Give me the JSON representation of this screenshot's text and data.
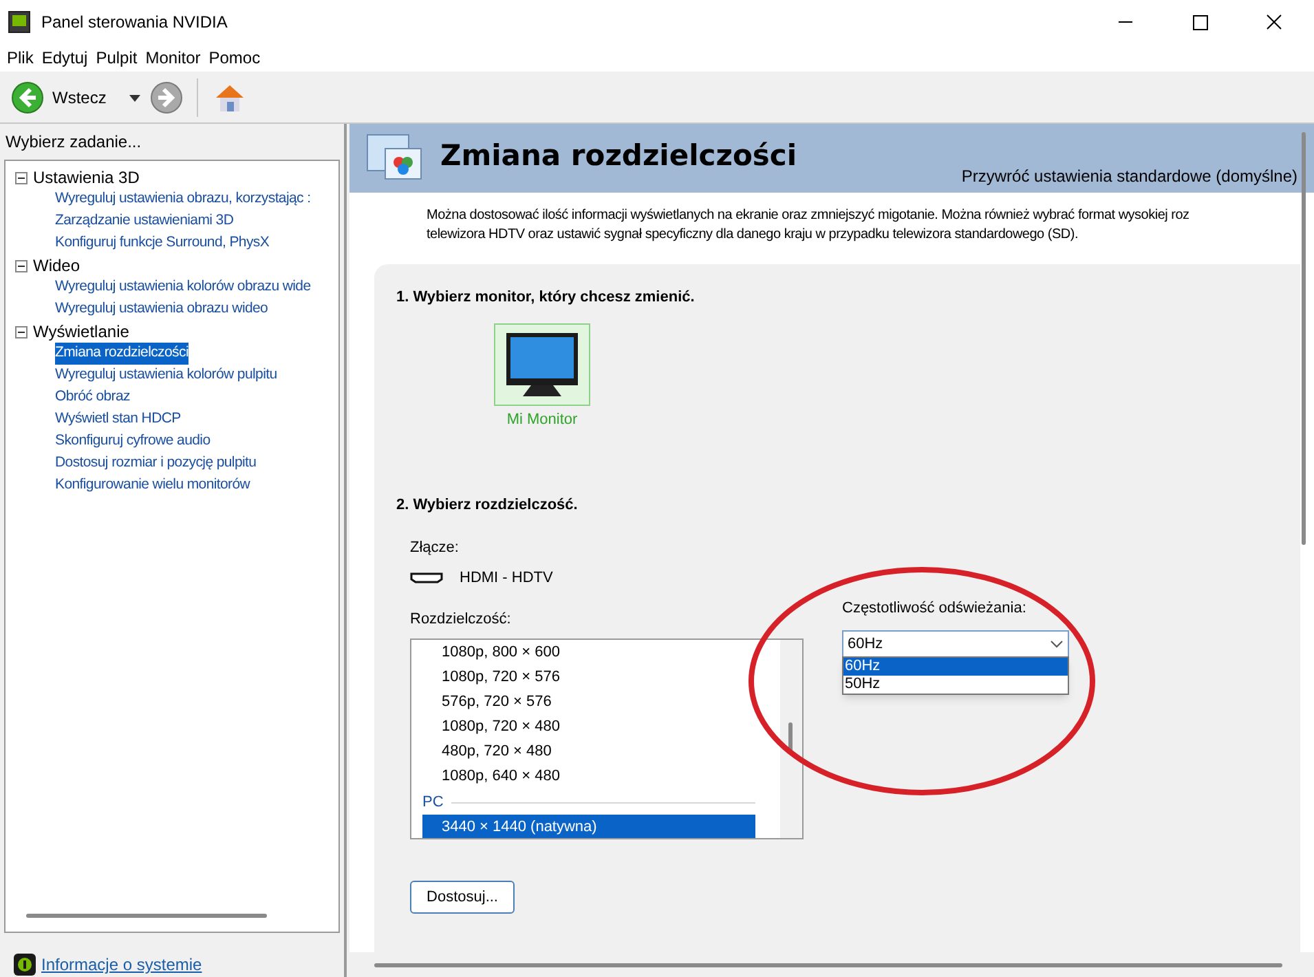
{
  "window": {
    "title": "Panel sterowania NVIDIA"
  },
  "menu": [
    "Plik",
    "Edytuj",
    "Pulpit",
    "Monitor",
    "Pomoc"
  ],
  "toolbar": {
    "back": "Wstecz"
  },
  "sidebar": {
    "heading": "Wybierz zadanie...",
    "tree": [
      {
        "label": "Ustawienia 3D",
        "expanded": true,
        "children": [
          {
            "label": "Wyreguluj ustawienia obrazu, korzystając :",
            "selected": false
          },
          {
            "label": "Zarządzanie ustawieniami 3D",
            "selected": false
          },
          {
            "label": "Konfiguruj funkcje Surround, PhysX",
            "selected": false
          }
        ]
      },
      {
        "label": "Wideo",
        "expanded": true,
        "children": [
          {
            "label": "Wyreguluj ustawienia kolorów obrazu wide",
            "selected": false
          },
          {
            "label": "Wyreguluj ustawienia obrazu wideo",
            "selected": false
          }
        ]
      },
      {
        "label": "Wyświetlanie",
        "expanded": true,
        "children": [
          {
            "label": "Zmiana rozdzielczości",
            "selected": true
          },
          {
            "label": "Wyreguluj ustawienia kolorów pulpitu",
            "selected": false
          },
          {
            "label": "Obróć obraz",
            "selected": false
          },
          {
            "label": "Wyświetl stan HDCP",
            "selected": false
          },
          {
            "label": "Skonfiguruj cyfrowe audio",
            "selected": false
          },
          {
            "label": "Dostosuj rozmiar i pozycję pulpitu",
            "selected": false
          },
          {
            "label": "Konfigurowanie wielu monitorów",
            "selected": false
          }
        ]
      }
    ],
    "footer_link": "Informacje o systemie"
  },
  "page": {
    "title": "Zmiana rozdzielczości",
    "restore_link": "Przywróć ustawienia standardowe (domyślne)",
    "description": [
      "Można dostosować ilość informacji wyświetlanych na ekranie oraz zmniejszyć migotanie. Można również wybrać format wysokiej roz",
      "telewizora HDTV oraz ustawić sygnał specyficzny dla danego kraju w przypadku telewizora standardowego (SD)."
    ],
    "step1": "1. Wybierz monitor, który chcesz zmienić.",
    "monitor": {
      "label": "Mi Monitor",
      "selected": true
    },
    "step2": "2. Wybierz rozdzielczość.",
    "connector_label": "Złącze:",
    "connector": "HDMI - HDTV",
    "resolution_label": "Rozdzielczość:",
    "resolutions": [
      {
        "kind": "item",
        "label": "1080p, 800 × 600",
        "selected": false
      },
      {
        "kind": "item",
        "label": "1080p, 720 × 576",
        "selected": false
      },
      {
        "kind": "item",
        "label": "576p, 720 × 576",
        "selected": false
      },
      {
        "kind": "item",
        "label": "1080p, 720 × 480",
        "selected": false
      },
      {
        "kind": "item",
        "label": "480p, 720 × 480",
        "selected": false
      },
      {
        "kind": "item",
        "label": "1080p, 640 × 480",
        "selected": false
      },
      {
        "kind": "group",
        "label": "PC"
      },
      {
        "kind": "item",
        "label": "3440 × 1440 (natywna)",
        "selected": true
      }
    ],
    "refresh_label": "Częstotliwość odświeżania:",
    "refresh_value": "60Hz",
    "refresh_options": [
      {
        "label": "60Hz",
        "selected": true
      },
      {
        "label": "50Hz",
        "selected": false
      }
    ],
    "customize_button": "Dostosuj..."
  }
}
